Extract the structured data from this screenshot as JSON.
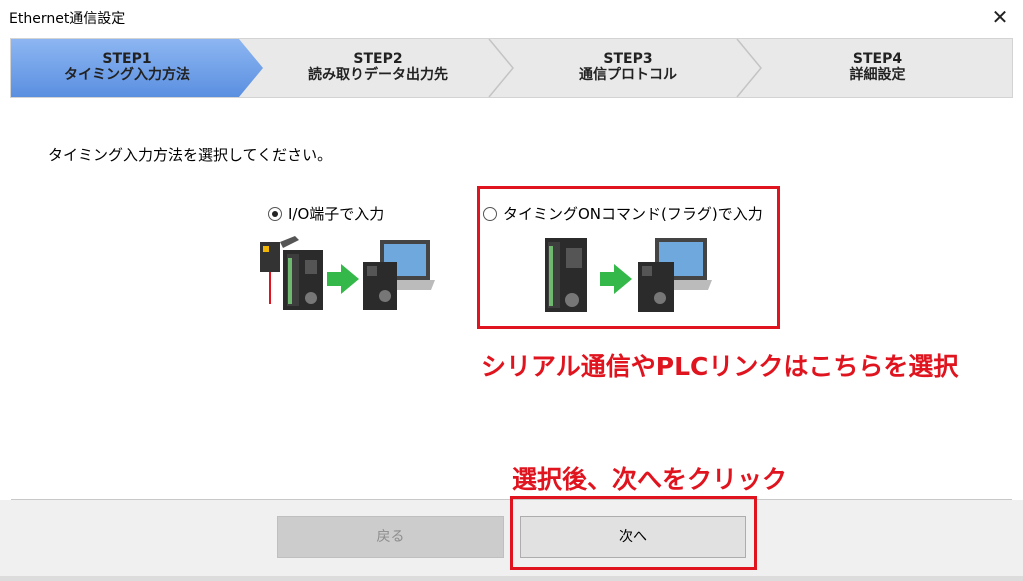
{
  "window": {
    "title": "Ethernet通信設定",
    "close_symbol": "✕"
  },
  "steps": [
    {
      "step": "STEP1",
      "label": "タイミング入力方法",
      "active": true
    },
    {
      "step": "STEP2",
      "label": "読み取りデータ出力先",
      "active": false
    },
    {
      "step": "STEP3",
      "label": "通信プロトコル",
      "active": false
    },
    {
      "step": "STEP4",
      "label": "詳細設定",
      "active": false
    }
  ],
  "instruction": "タイミング入力方法を選択してください。",
  "options": [
    {
      "label": "I/O端子で入力",
      "selected": true
    },
    {
      "label": "タイミングONコマンド(フラグ)で入力",
      "selected": false
    }
  ],
  "annotations": {
    "option_note": "シリアル通信やPLCリンクはこちらを選択",
    "next_note": "選択後、次へをクリック"
  },
  "buttons": {
    "back": "戻る",
    "next": "次へ",
    "back_enabled": false
  },
  "colors": {
    "accent_step": "#5b92e0",
    "annotation_red": "#e0141e",
    "arrow_green": "#35b84a"
  }
}
